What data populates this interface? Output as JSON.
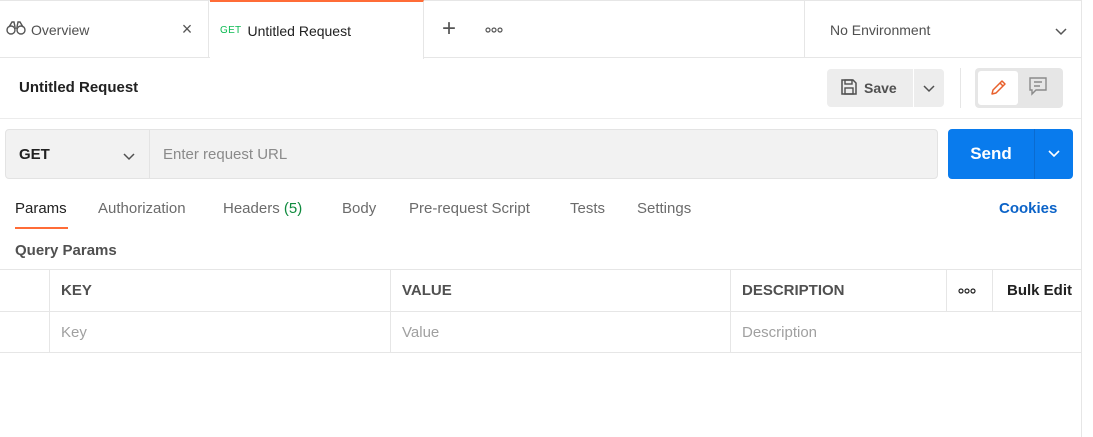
{
  "tabs": {
    "overview": {
      "label": "Overview",
      "icon": "binoculars-icon",
      "close_icon": "close-icon"
    },
    "request": {
      "method": "GET",
      "label": "Untitled Request",
      "accent": "#ff6c37",
      "method_color": "#0cbb52"
    },
    "add_icon": "plus-icon",
    "more_icon": "more-horizontal-icon"
  },
  "environment": {
    "selected": "No Environment"
  },
  "request": {
    "title": "Untitled Request",
    "save_label": "Save",
    "method": "GET",
    "url_placeholder": "Enter request URL",
    "url_value": "",
    "send_label": "Send",
    "send_color": "#097bed"
  },
  "subtabs": {
    "params": "Params",
    "authorization": "Authorization",
    "headers": "Headers",
    "headers_count": "(5)",
    "body": "Body",
    "prerequest": "Pre-request Script",
    "tests": "Tests",
    "settings": "Settings",
    "cookies": "Cookies"
  },
  "query_params": {
    "title": "Query Params",
    "columns": [
      "KEY",
      "VALUE",
      "DESCRIPTION"
    ],
    "bulk_edit": "Bulk Edit",
    "placeholders": {
      "key": "Key",
      "value": "Value",
      "description": "Description"
    }
  }
}
